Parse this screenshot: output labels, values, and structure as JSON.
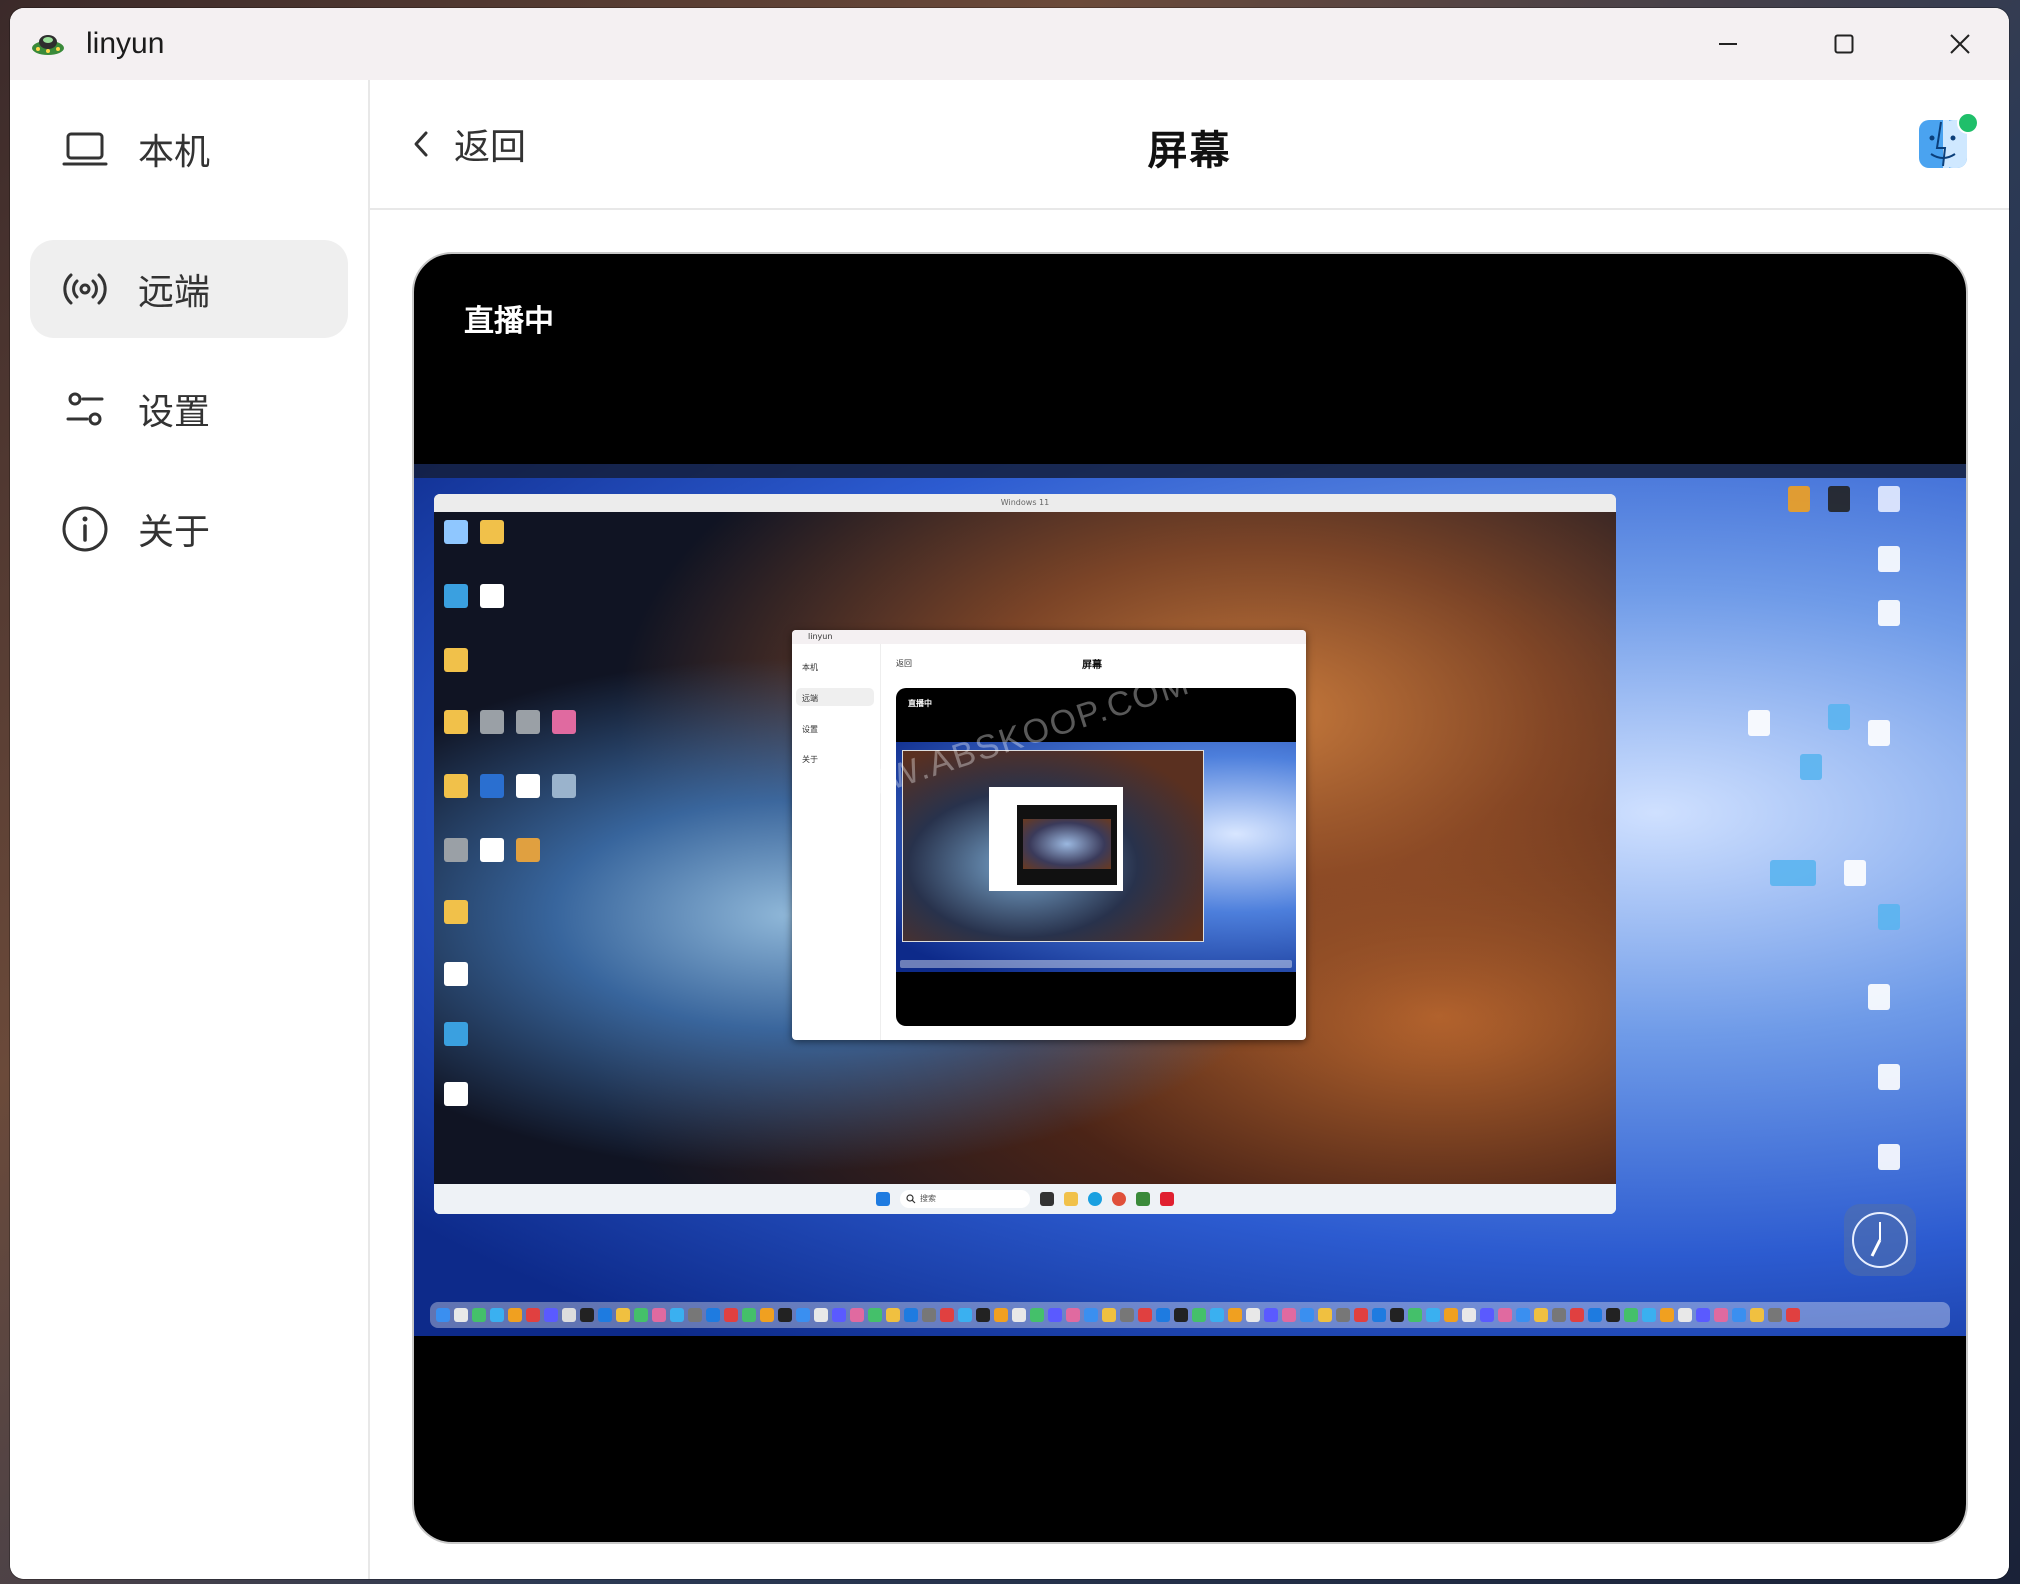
{
  "window": {
    "title": "linyun"
  },
  "sidebar": {
    "items": [
      {
        "label": "本机",
        "icon": "laptop-icon"
      },
      {
        "label": "远端",
        "icon": "broadcast-icon"
      },
      {
        "label": "设置",
        "icon": "sliders-icon"
      },
      {
        "label": "关于",
        "icon": "info-icon"
      }
    ],
    "active_index": 1
  },
  "header": {
    "back_label": "返回",
    "title": "屏幕",
    "avatar_icon": "finder-icon",
    "status": "online"
  },
  "stream": {
    "status_label": "直播中",
    "remote_window_title": "Windows 11",
    "nested_app_title": "linyun",
    "nested_back_label": "返回",
    "nested_title": "屏幕",
    "nested_status_label": "直播中",
    "nested_sidebar": [
      "本机",
      "远端",
      "设置",
      "关于"
    ],
    "watermark": "WWW.ABSKOOP.COM",
    "taskbar_search_placeholder": "搜索"
  },
  "colors": {
    "accent_active_bg": "#efefef",
    "status_dot": "#1fbf6a",
    "stream_bg": "#000000"
  }
}
